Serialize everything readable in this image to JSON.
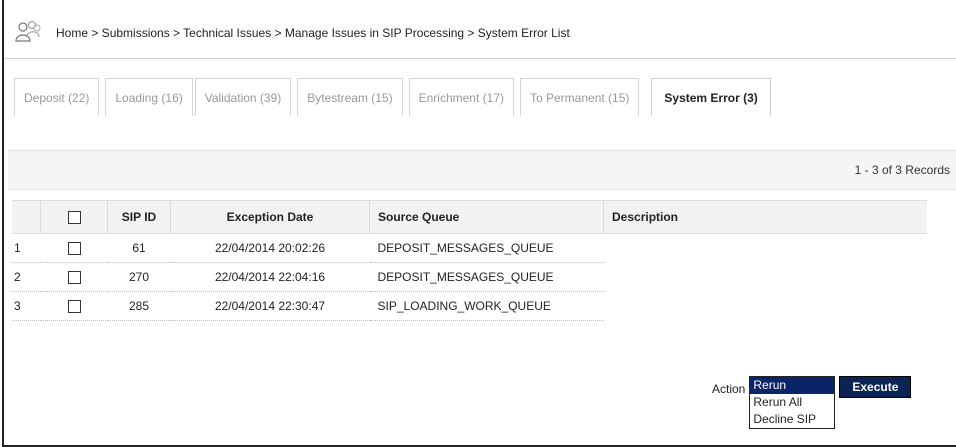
{
  "breadcrumb": "Home > Submissions > Technical Issues > Manage Issues in SIP Processing > System Error List",
  "tabs": [
    {
      "label": "Deposit (22)"
    },
    {
      "label": "Loading (16)"
    },
    {
      "label": "Validation (39)"
    },
    {
      "label": "Bytestream (15)"
    },
    {
      "label": "Enrichment (17)"
    },
    {
      "label": "To Permanent (15)"
    },
    {
      "label": "System Error (3)",
      "active": true
    }
  ],
  "records_label": "1 - 3 of 3 Records",
  "table": {
    "headers": [
      "SIP ID",
      "Exception Date",
      "Source Queue",
      "Description"
    ],
    "rows": [
      {
        "num": "1",
        "sip_id": "61",
        "date": "22/04/2014 20:02:26",
        "queue": "DEPOSIT_MESSAGES_QUEUE",
        "description": ""
      },
      {
        "num": "2",
        "sip_id": "270",
        "date": "22/04/2014 22:04:16",
        "queue": "DEPOSIT_MESSAGES_QUEUE",
        "description": ""
      },
      {
        "num": "3",
        "sip_id": "285",
        "date": "22/04/2014 22:30:47",
        "queue": "SIP_LOADING_WORK_QUEUE",
        "description": ""
      }
    ]
  },
  "action": {
    "label": "Action",
    "options": [
      "Rerun",
      "Rerun All",
      "Decline SIP"
    ],
    "selected": "Rerun",
    "execute_label": "Execute"
  },
  "colors": {
    "execute_bg": "#0b2454",
    "selected_option_bg": "#0a246a"
  }
}
